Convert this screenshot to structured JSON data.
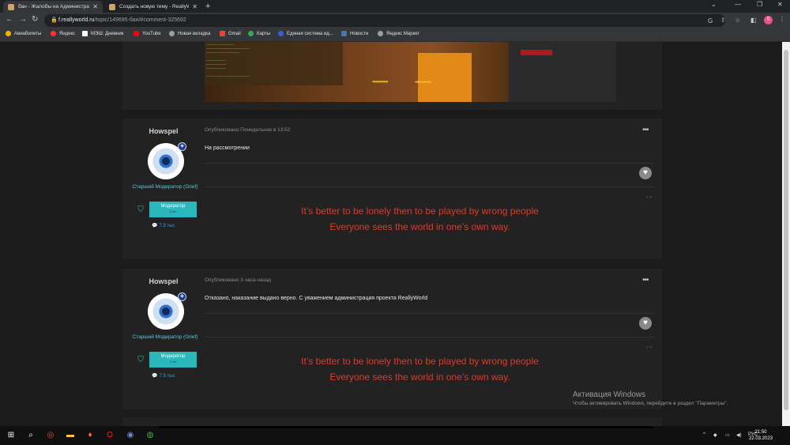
{
  "browser": {
    "tabs": [
      {
        "title": "бан - Жалобы на Администрац",
        "active": true
      },
      {
        "title": "Создать новую тему - ReallyWo",
        "active": false
      }
    ],
    "new_tab": "+",
    "url_domain": "f.reallyworld.ru",
    "url_path": "/topic/149695-бан/#comment-325692",
    "profile_initial": "S"
  },
  "bookmarks": [
    {
      "label": "Авиабилеты",
      "color": "#f4b400"
    },
    {
      "label": "Яндекс",
      "color": "#ff3333"
    },
    {
      "label": "МЭШ: Дневник",
      "color": "#ffffff"
    },
    {
      "label": "YouTube",
      "color": "#ff0000"
    },
    {
      "label": "Новая вкладка",
      "color": "#9aa0a6"
    },
    {
      "label": "Gmail",
      "color": "#ea4335"
    },
    {
      "label": "Карты",
      "color": "#34a853"
    },
    {
      "label": "Единая система ид...",
      "color": "#3b5bdb"
    },
    {
      "label": "Новости",
      "color": "#4a76a8"
    },
    {
      "label": "Яндекс Маркет",
      "color": "#9aa0a6"
    }
  ],
  "posts": [
    {
      "author": "Howspel",
      "role": "Старший Модератор (Grief)",
      "group_label": "Модератор",
      "group_sub": "Grief",
      "reputation": "7.9 тыс",
      "meta": "Опубликовано Понедельник в 13:52",
      "content": "На рассмотрении",
      "signature_line1": "It’s better to be lonely then to be played by wrong people",
      "signature_line2": "Everyone sees the world in one’s own way."
    },
    {
      "author": "Howspel",
      "role": "Старший Модератор (Grief)",
      "group_label": "Модератор",
      "group_sub": "Grief",
      "reputation": "7.9 тыс",
      "meta": "Опубликовано 3 часа назад",
      "content": "Отказано, наказание выдано верно. С уважением администрация проекта ReallyWorld",
      "signature_line1": "It’s better to be lonely then to be played by wrong people",
      "signature_line2": "Everyone sees the world in one’s own way."
    }
  ],
  "activation": {
    "title": "Активация Windows",
    "subtitle": "Чтобы активировать Windows, перейдите в раздел \"Параметры\"."
  },
  "taskbar": {
    "lang": "РУС",
    "time": "21:50",
    "date": "22.03.2023"
  }
}
